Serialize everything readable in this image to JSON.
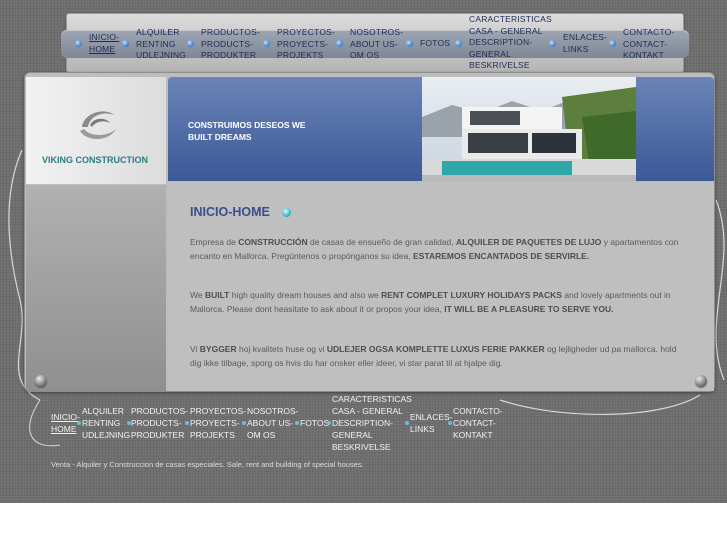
{
  "colors": {
    "nav_text": "#1e2a52",
    "banner_blue": "#4c669f",
    "logo_teal": "#2a7d83",
    "heading": "#3a4d8c"
  },
  "nav": {
    "items": [
      {
        "label": "Inicio-\nHome",
        "active": true
      },
      {
        "label": "Alquiler\nRenting\nUdlejning"
      },
      {
        "label": "Productos-\nProducts-\nProdukter"
      },
      {
        "label": "Proyectos-\nProyects-\nProjekts"
      },
      {
        "label": "Nosotros-\nAbout us-\nOm os"
      },
      {
        "label": "Fotos"
      },
      {
        "label": "Caracteristicas\ncasa - General\nDescription-\nGeneral\nBeskrivelse"
      },
      {
        "label": "Enlaces-\nLinks"
      },
      {
        "label": "Contacto-\nContact-\nKontakt"
      }
    ]
  },
  "logo": {
    "text": "VIKING CONSTRUCTION",
    "icon": "swoosh-logo-icon"
  },
  "banner": {
    "tagline": "CONSTRUIMOS DESEOS WE BUILT DREAMS",
    "image": "modern-house-photo"
  },
  "content": {
    "title": "INICIO-HOME",
    "p1": {
      "a": "Empresa de ",
      "b": "CONSTRUCCIÓN",
      "c": " de casas de ensueño de gran calidad, ",
      "d": "ALQUILER DE PAQUETES DE LUJO",
      "e": " y apartamentos con encanto en Mallorca. Pregúntenos o propónganos su idea, ",
      "f": "ESTAREMOS ENCANTADOS DE SERVIRLE."
    },
    "p2": {
      "a": "We ",
      "b": "BUILT",
      "c": "  high quality dream houses and also we ",
      "d": "RENT COMPLET LUXURY HOLIDAYS PACKS",
      "e": " and lovely apartments out in Mallorca. Please dont heasitate to ask about it or propos your idea, ",
      "f": "IT WILL BE A PLEASURE TO SERVE YOU."
    },
    "p3": {
      "a": "Vi ",
      "b": "BYGGER",
      "c": " hoj kvalitets huse og vi ",
      "d": "UDLEJER OGSA KOMPLETTE LUXUS FERIE PAKKER",
      "e": " og lejligheder ud pa mallorca. hold dig ikke tilbage, sporg os hvis du har onsker eller ideer, vi star parat til at hjalpe dig."
    }
  },
  "footer": {
    "copyright": "Venta - Alquiler y Construccion de casas especiales. Sale, rent and building of special houses."
  }
}
